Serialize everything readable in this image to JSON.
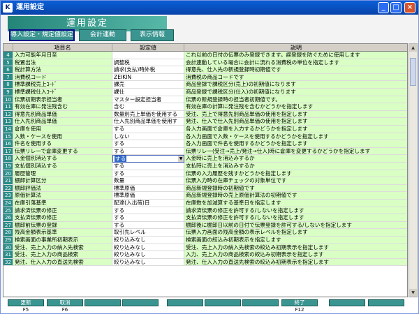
{
  "window": {
    "title": "運用設定",
    "min_label": "_",
    "max_label": "□",
    "close_label": "×"
  },
  "banner": "運用設定",
  "tabs": [
    {
      "label": "導入設定・規定値設定",
      "active": true
    },
    {
      "label": "会計連動",
      "active": false
    },
    {
      "label": "表示情報",
      "active": false
    }
  ],
  "table": {
    "headers": [
      "",
      "項目名",
      "設定値",
      "説明"
    ],
    "rows": [
      {
        "n": "4",
        "name": "入力可能年月日至",
        "value": "",
        "desc": "これ以前の日付の伝票のみ登録できます。誤登録を防ぐために使用します"
      },
      {
        "n": "5",
        "name": "税置出法",
        "value": "調整税",
        "desc": "会計連動している場合に会計に流れる消費税の単位を指定します"
      },
      {
        "n": "6",
        "name": "税計算方法",
        "value": "請求(支払)時外税",
        "desc": "得意先、仕入先の新規登録時初期値です"
      },
      {
        "n": "7",
        "name": "消費税コード",
        "value": "ZEIKIN",
        "desc": "消費税の商品コードです"
      },
      {
        "n": "8",
        "name": "標準課税売上ｺｰﾄﾞ",
        "value": "課売",
        "desc": "商品登録で課税区分(売上)の初期値になります"
      },
      {
        "n": "9",
        "name": "標準課税仕入ｺｰﾄﾞ",
        "value": "課仕",
        "desc": "商品登録で課税区分(仕入)の初期値になります"
      },
      {
        "n": "10",
        "name": "伝票初期表示担当者",
        "value": "マスター設定担当者",
        "desc": "伝票の新規登録時の担当者初期値です。"
      },
      {
        "n": "11",
        "name": "有効在庫に発注残含む",
        "value": "含む",
        "desc": "有効在庫の計算に発注残を含むかどうかを指定します"
      },
      {
        "n": "12",
        "name": "得意先別商品単価",
        "value": "数量別売上単価を使用する",
        "desc": "受注、売上で得意先別商品単価の使用を指定します"
      },
      {
        "n": "13",
        "name": "仕入先別商品単価",
        "value": "仕入先別商品単価を使用す",
        "desc": "発注、仕入で仕入先別商品単価の使用を指定します"
      },
      {
        "n": "14",
        "name": "倉庫を使用",
        "value": "する",
        "desc": "各入力画面で倉庫を入力するかどうかを指定します"
      },
      {
        "n": "15",
        "name": "入数・ケースを使用",
        "value": "しない",
        "desc": "各入力画面で入数・ケースを使用するかどうかを指定します"
      },
      {
        "n": "16",
        "name": "件名を使用する",
        "value": "する",
        "desc": "各入力画面で件名を使用するかどうかを指定します"
      },
      {
        "n": "17",
        "name": "伝票リレーで倉庫変更する",
        "value": "する",
        "desc": "伝票リレー(受注→売上/発注→仕入)時に倉庫を変更するかどうかを指定します"
      },
      {
        "n": "18",
        "name": "入金個別消込する",
        "value": "する",
        "desc": "入金時に売上を消込みするか",
        "selected": true
      },
      {
        "n": "19",
        "name": "支払個別消込する",
        "value": "する",
        "desc": "支払時に売上を消込みするか"
      },
      {
        "n": "20",
        "name": "履歴管理",
        "value": "する",
        "desc": "伝票の入力履歴を残すかどうかを指定します"
      },
      {
        "n": "21",
        "name": "棚卸計算区分",
        "value": "数量",
        "desc": "伝票入力時の在庫チェックの対象単位です"
      },
      {
        "n": "22",
        "name": "棚卸評価法",
        "value": "標準原価",
        "desc": "商品新規登録時の初期値です"
      },
      {
        "n": "23",
        "name": "原価計算法",
        "value": "標準原価",
        "desc": "商品新規登録時の売上原価計算法の初期値です"
      },
      {
        "n": "24",
        "name": "在庫引落基準",
        "value": "配達(入出荷)日",
        "desc": "在庫数を加減算する基準日を指定します"
      },
      {
        "n": "25",
        "name": "請求済伝票の修正",
        "value": "する",
        "desc": "請求済伝票の修正を許可する/しないを指定します"
      },
      {
        "n": "26",
        "name": "支払済伝票の修正",
        "value": "する",
        "desc": "支払済伝票の修正を許可する/しないを指定します"
      },
      {
        "n": "27",
        "name": "棚卸前伝票の登録",
        "value": "する",
        "desc": "棚卸後に棚卸日以前の日付で伝票登録を許可する/しないを指定します"
      },
      {
        "n": "28",
        "name": "残高金額表示基準",
        "value": "取引先レベル",
        "desc": "伝票入力画面の残高金額の表示レベルを指定します"
      },
      {
        "n": "29",
        "name": "検索画面の事業所初期表示",
        "value": "絞り込みなし",
        "desc": "検索画面の絞込み初期表示を指定します"
      },
      {
        "n": "30",
        "name": "受注、売上入力の納入先検索",
        "value": "絞り込みなし",
        "desc": "受注、売上入力の納入先検索の絞込み初期表示を指定します"
      },
      {
        "n": "31",
        "name": "受注、売上入力の商品検索",
        "value": "絞り込みなし",
        "desc": "入力、売上入力の商品検索の絞込み初期表示を指定します"
      },
      {
        "n": "32",
        "name": "発注、仕入入力の直送先検索",
        "value": "絞り込みなし",
        "desc": "発注、仕入入力の直送先検索の絞込み初期表示を指定します"
      }
    ]
  },
  "fkeys": [
    {
      "label": "更新",
      "key": "F5"
    },
    {
      "label": "取消",
      "key": "F6"
    },
    {
      "label": "",
      "key": ""
    },
    {
      "label": "",
      "key": ""
    },
    {
      "label": "",
      "key": ""
    },
    {
      "label": "",
      "key": ""
    },
    {
      "label": "",
      "key": ""
    },
    {
      "label": "終了",
      "key": "F12"
    },
    {
      "label": "",
      "key": ""
    },
    {
      "label": "",
      "key": ""
    }
  ]
}
